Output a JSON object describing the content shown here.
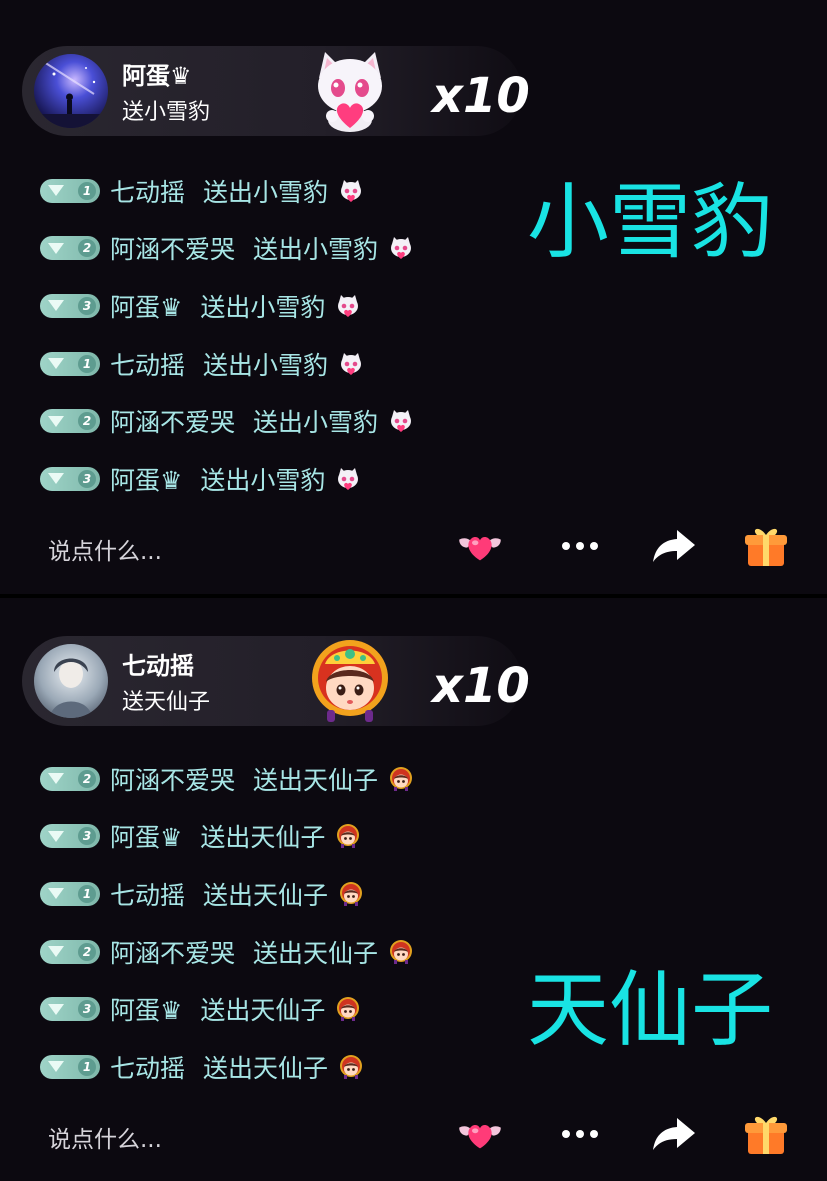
{
  "panels": [
    {
      "banner": {
        "sender": "阿蛋♛",
        "gift_text": "送小雪豹",
        "multiplier": "x10"
      },
      "label": "小雪豹",
      "messages": [
        {
          "level": "1",
          "user": "七动摇",
          "action": "送出小雪豹"
        },
        {
          "level": "2",
          "user": "阿涵不爱哭",
          "action": "送出小雪豹"
        },
        {
          "level": "3",
          "user": "阿蛋♛",
          "action": "送出小雪豹"
        },
        {
          "level": "1",
          "user": "七动摇",
          "action": "送出小雪豹"
        },
        {
          "level": "2",
          "user": "阿涵不爱哭",
          "action": "送出小雪豹"
        },
        {
          "level": "3",
          "user": "阿蛋♛",
          "action": "送出小雪豹"
        }
      ],
      "input_placeholder": "说点什么..."
    },
    {
      "banner": {
        "sender": "七动摇",
        "gift_text": "送天仙子",
        "multiplier": "x10"
      },
      "label": "天仙子",
      "messages": [
        {
          "level": "2",
          "user": "阿涵不爱哭",
          "action": "送出天仙子"
        },
        {
          "level": "3",
          "user": "阿蛋♛",
          "action": "送出天仙子"
        },
        {
          "level": "1",
          "user": "七动摇",
          "action": "送出天仙子"
        },
        {
          "level": "2",
          "user": "阿涵不爱哭",
          "action": "送出天仙子"
        },
        {
          "level": "3",
          "user": "阿蛋♛",
          "action": "送出天仙子"
        },
        {
          "level": "1",
          "user": "七动摇",
          "action": "送出天仙子"
        }
      ],
      "input_placeholder": "说点什么..."
    }
  ],
  "icons": {
    "like": "heart-wings-icon",
    "more": "more-dots-icon",
    "share": "share-arrow-icon",
    "gift": "gift-box-icon"
  },
  "colors": {
    "accent_cyan": "#19e3e3",
    "message_text": "#a8e6e6",
    "badge": "#8ec9bc",
    "background": "#0c0910"
  }
}
